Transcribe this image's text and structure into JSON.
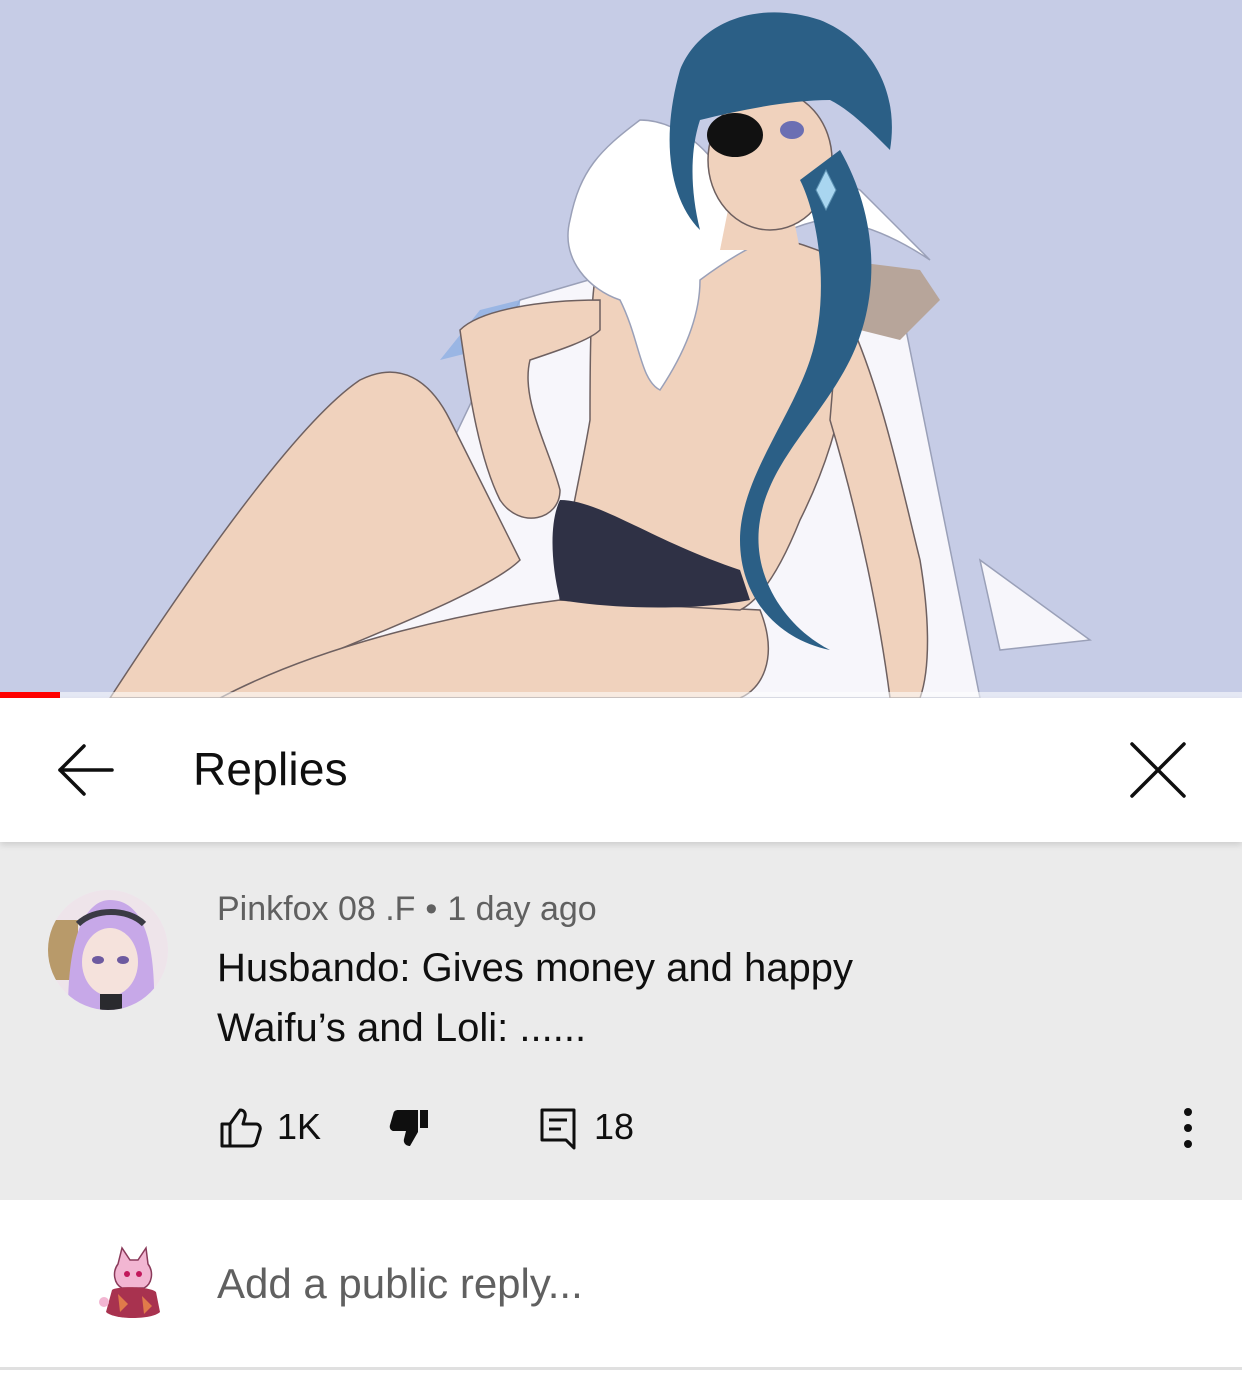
{
  "player": {
    "progress_fraction": 0.048,
    "progress_color": "#ff0000",
    "background_color": "#c6cce6"
  },
  "header": {
    "title": "Replies",
    "back_icon": "arrow-left-icon",
    "close_icon": "close-icon"
  },
  "comment": {
    "author": "Pinkfox 08 .F",
    "separator": "•",
    "time": "1 day ago",
    "text_line1": "Husbando: Gives money and happy",
    "text_line2": "Waifu’s and Loli: ......",
    "like_count": "1K",
    "reply_count": "18",
    "icons": {
      "like": "thumbs-up-icon",
      "dislike": "thumbs-down-icon",
      "reply": "reply-comment-icon",
      "more": "more-vertical-icon"
    }
  },
  "reply_box": {
    "placeholder": "Add a public reply..."
  }
}
